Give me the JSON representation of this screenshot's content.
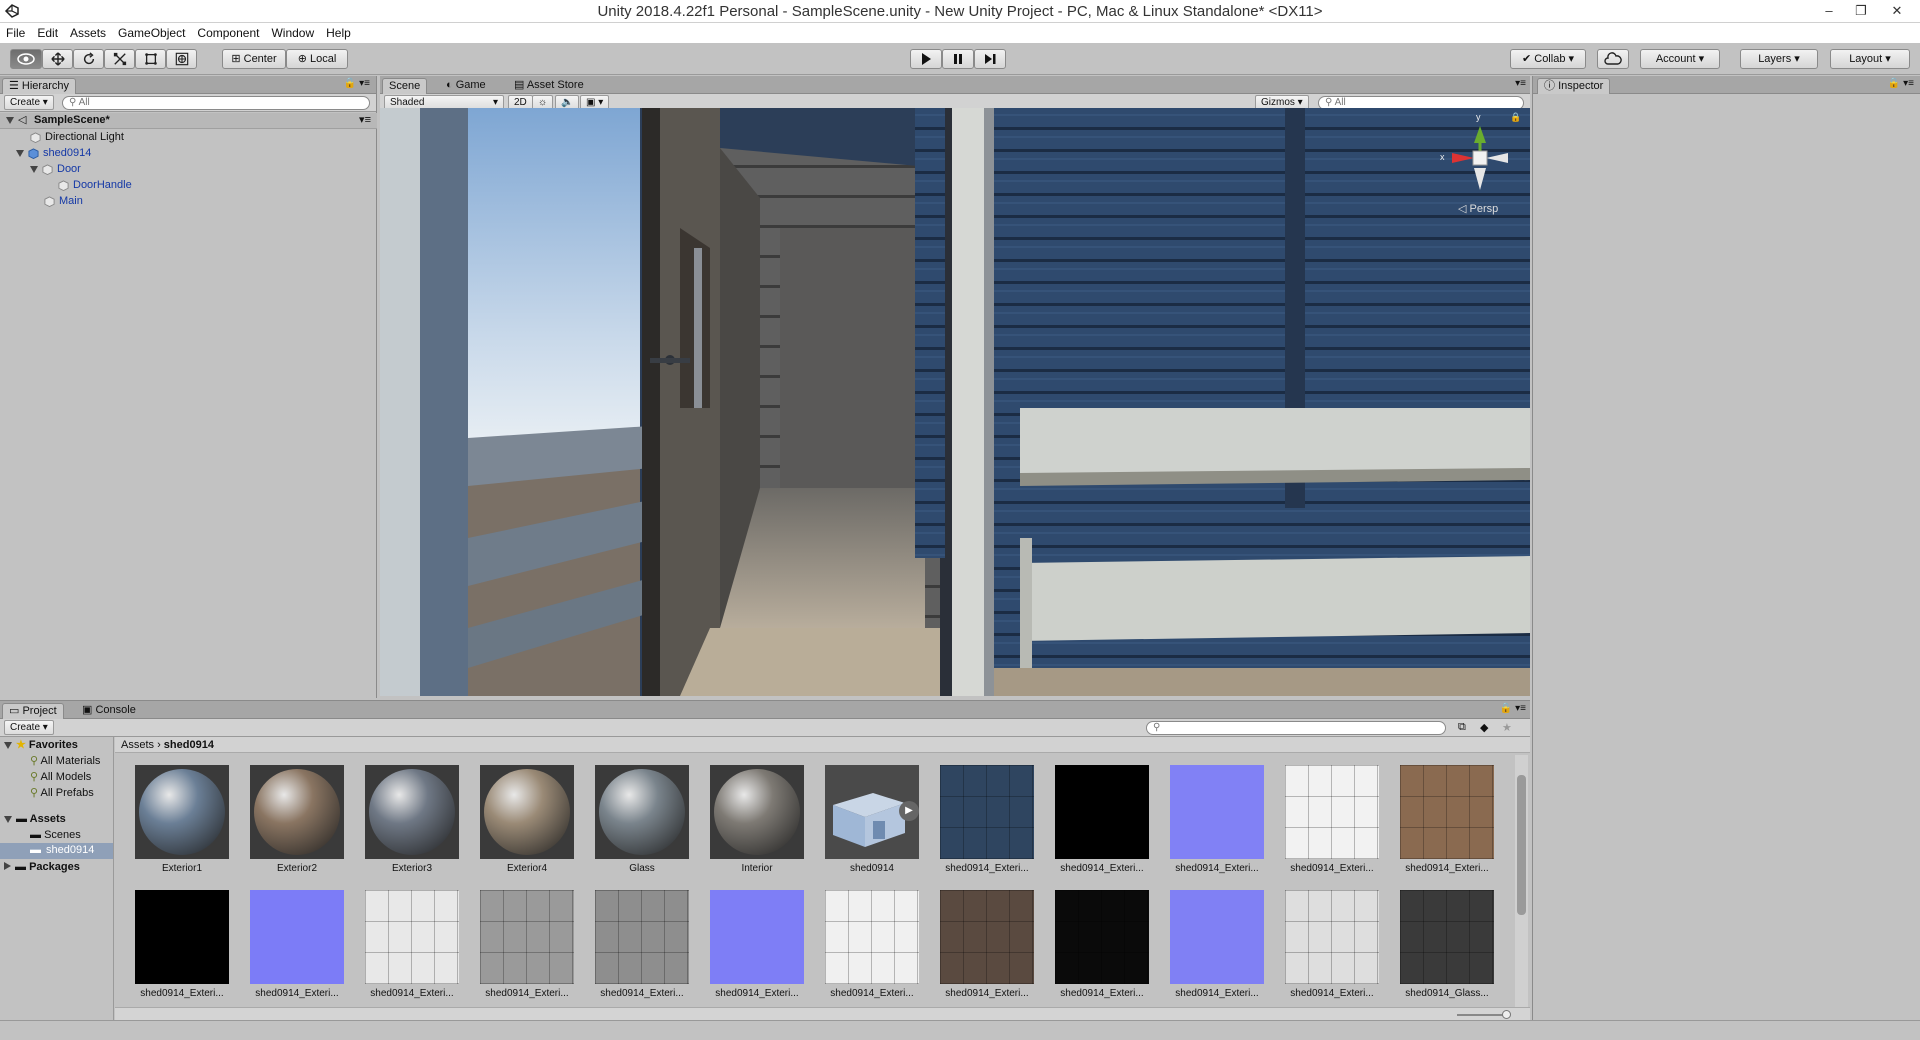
{
  "window": {
    "title": "Unity 2018.4.22f1 Personal - SampleScene.unity - New Unity Project - PC, Mac & Linux Standalone* <DX11>",
    "minimize": "–",
    "restore": "❐",
    "close": "✕"
  },
  "menu": [
    "File",
    "Edit",
    "Assets",
    "GameObject",
    "Component",
    "Window",
    "Help"
  ],
  "toolbar": {
    "pivot": "Center",
    "space": "Local",
    "collab": "Collab",
    "account": "Account",
    "layers": "Layers",
    "layout": "Layout"
  },
  "hierarchy": {
    "tab": "Hierarchy",
    "create": "Create",
    "search_placeholder": "All",
    "scene": "SampleScene*",
    "items": [
      {
        "label": "Directional Light"
      },
      {
        "label": "shed0914"
      },
      {
        "label": "Door"
      },
      {
        "label": "DoorHandle"
      },
      {
        "label": "Main"
      }
    ]
  },
  "scene_view": {
    "tabs": [
      "Scene",
      "Game",
      "Asset Store"
    ],
    "shading": "Shaded",
    "mode_2d": "2D",
    "gizmos": "Gizmos",
    "search_placeholder": "All",
    "gizmo_y": "y",
    "gizmo_x": "x",
    "persp": "Persp"
  },
  "inspector": {
    "tab": "Inspector"
  },
  "project": {
    "tabs": [
      "Project",
      "Console"
    ],
    "create": "Create",
    "favorites_header": "Favorites",
    "favorites": [
      "All Materials",
      "All Models",
      "All Prefabs"
    ],
    "assets_header": "Assets",
    "folders": [
      "Scenes",
      "shed0914"
    ],
    "packages_header": "Packages",
    "breadcrumb": [
      "Assets",
      "shed0914"
    ],
    "assets": [
      {
        "name": "Exterior1",
        "kind": "sphere",
        "color": "#6b7f96"
      },
      {
        "name": "Exterior2",
        "kind": "sphere",
        "color": "#8a7562"
      },
      {
        "name": "Exterior3",
        "kind": "sphere",
        "color": "#6f7885"
      },
      {
        "name": "Exterior4",
        "kind": "sphere",
        "color": "#9a8a76"
      },
      {
        "name": "Glass",
        "kind": "sphere",
        "color": "#7a848c"
      },
      {
        "name": "Interior",
        "kind": "sphere",
        "color": "#7e7a74"
      },
      {
        "name": "shed0914",
        "kind": "model",
        "color": "#9fb7d6"
      },
      {
        "name": "shed0914_Exteri...",
        "kind": "texture",
        "color": "#2f4560"
      },
      {
        "name": "shed0914_Exteri...",
        "kind": "flat",
        "color": "#000000"
      },
      {
        "name": "shed0914_Exteri...",
        "kind": "flat",
        "color": "#8181f5"
      },
      {
        "name": "shed0914_Exteri...",
        "kind": "texture",
        "color": "#f2f2f2"
      },
      {
        "name": "shed0914_Exteri...",
        "kind": "texture",
        "color": "#8a6a50"
      },
      {
        "name": "shed0914_Exteri...",
        "kind": "flat",
        "color": "#000000"
      },
      {
        "name": "shed0914_Exteri...",
        "kind": "flat",
        "color": "#7c7cf7"
      },
      {
        "name": "shed0914_Exteri...",
        "kind": "texture",
        "color": "#e8e8e8"
      },
      {
        "name": "shed0914_Exteri...",
        "kind": "texture",
        "color": "#9a9a9a"
      },
      {
        "name": "shed0914_Exteri...",
        "kind": "texture",
        "color": "#8e8e8e"
      },
      {
        "name": "shed0914_Exteri...",
        "kind": "flat",
        "color": "#7e7ef6"
      },
      {
        "name": "shed0914_Exteri...",
        "kind": "texture",
        "color": "#f0f0f0"
      },
      {
        "name": "shed0914_Exteri...",
        "kind": "texture",
        "color": "#5a4a40"
      },
      {
        "name": "shed0914_Exteri...",
        "kind": "texture",
        "color": "#0a0a0a"
      },
      {
        "name": "shed0914_Exteri...",
        "kind": "flat",
        "color": "#8080f4"
      },
      {
        "name": "shed0914_Exteri...",
        "kind": "texture",
        "color": "#dedede"
      },
      {
        "name": "shed0914_Glass...",
        "kind": "texture",
        "color": "#3a3a3a"
      }
    ]
  },
  "colors": {
    "selection": "#3d6fb6",
    "link": "#1438a6"
  }
}
